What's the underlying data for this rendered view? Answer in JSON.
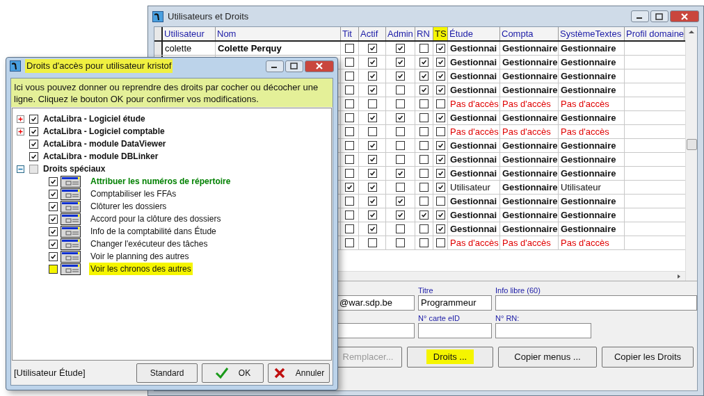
{
  "back_window": {
    "title": "Utilisateurs et Droits",
    "table": {
      "columns": [
        {
          "label": "Utilisateur",
          "highlighted": false
        },
        {
          "label": "Nom",
          "highlighted": false
        },
        {
          "label": "Tit",
          "highlighted": false
        },
        {
          "label": "Actif",
          "highlighted": false
        },
        {
          "label": "Admin",
          "highlighted": false
        },
        {
          "label": "RN",
          "highlighted": false
        },
        {
          "label": "TS",
          "highlighted": true
        },
        {
          "label": "Étude",
          "highlighted": false
        },
        {
          "label": "Compta",
          "highlighted": false
        },
        {
          "label": "SystèmeTextes",
          "highlighted": false
        },
        {
          "label": "Profil domaine",
          "highlighted": false
        }
      ],
      "rows": [
        {
          "utilisateur": "colette",
          "nom": "Colette Perquy",
          "flags": [
            false,
            true,
            true,
            false,
            true
          ],
          "cells": [
            {
              "text": "Gestionnai",
              "kind": "manager"
            },
            {
              "text": "Gestionnaire",
              "kind": "manager"
            },
            {
              "text": "Gestionnaire",
              "kind": "manager"
            }
          ]
        },
        {
          "flags": [
            false,
            true,
            true,
            true,
            true
          ],
          "cells": [
            {
              "text": "Gestionnai",
              "kind": "manager"
            },
            {
              "text": "Gestionnaire",
              "kind": "manager"
            },
            {
              "text": "Gestionnaire",
              "kind": "manager"
            }
          ]
        },
        {
          "flags": [
            false,
            true,
            true,
            true,
            true
          ],
          "cells": [
            {
              "text": "Gestionnai",
              "kind": "manager"
            },
            {
              "text": "Gestionnaire",
              "kind": "manager"
            },
            {
              "text": "Gestionnaire",
              "kind": "manager"
            }
          ]
        },
        {
          "flags": [
            false,
            true,
            false,
            true,
            true
          ],
          "cells": [
            {
              "text": "Gestionnai",
              "kind": "manager"
            },
            {
              "text": "Gestionnaire",
              "kind": "manager"
            },
            {
              "text": "Gestionnaire",
              "kind": "manager"
            }
          ]
        },
        {
          "flags": [
            false,
            false,
            false,
            false,
            false
          ],
          "cells": [
            {
              "text": "Pas d'accès",
              "kind": "none"
            },
            {
              "text": "Pas d'accès",
              "kind": "none"
            },
            {
              "text": "Pas d'accès",
              "kind": "none"
            }
          ]
        },
        {
          "flags": [
            false,
            true,
            true,
            false,
            true
          ],
          "cells": [
            {
              "text": "Gestionnai",
              "kind": "manager"
            },
            {
              "text": "Gestionnaire",
              "kind": "manager"
            },
            {
              "text": "Gestionnaire",
              "kind": "manager"
            }
          ]
        },
        {
          "flags": [
            false,
            false,
            false,
            false,
            false
          ],
          "cells": [
            {
              "text": "Pas d'accès",
              "kind": "none"
            },
            {
              "text": "Pas d'accès",
              "kind": "none"
            },
            {
              "text": "Pas d'accès",
              "kind": "none"
            }
          ]
        },
        {
          "flags": [
            false,
            true,
            false,
            false,
            true
          ],
          "cells": [
            {
              "text": "Gestionnai",
              "kind": "manager"
            },
            {
              "text": "Gestionnaire",
              "kind": "manager"
            },
            {
              "text": "Gestionnaire",
              "kind": "manager"
            }
          ]
        },
        {
          "flags": [
            false,
            true,
            false,
            false,
            true
          ],
          "cells": [
            {
              "text": "Gestionnai",
              "kind": "manager"
            },
            {
              "text": "Gestionnaire",
              "kind": "manager"
            },
            {
              "text": "Gestionnaire",
              "kind": "manager"
            }
          ]
        },
        {
          "flags": [
            false,
            true,
            true,
            false,
            true
          ],
          "cells": [
            {
              "text": "Gestionnai",
              "kind": "manager"
            },
            {
              "text": "Gestionnaire",
              "kind": "manager"
            },
            {
              "text": "Gestionnaire",
              "kind": "manager"
            }
          ]
        },
        {
          "flags": [
            true,
            true,
            false,
            false,
            true
          ],
          "cells": [
            {
              "text": "Utilisateur",
              "kind": "user"
            },
            {
              "text": "Gestionnaire",
              "kind": "manager"
            },
            {
              "text": "Utilisateur",
              "kind": "user"
            }
          ]
        },
        {
          "flags": [
            false,
            true,
            true,
            false,
            false
          ],
          "cells": [
            {
              "text": "Gestionnai",
              "kind": "manager"
            },
            {
              "text": "Gestionnaire",
              "kind": "manager"
            },
            {
              "text": "Gestionnaire",
              "kind": "manager"
            }
          ]
        },
        {
          "flags": [
            false,
            true,
            true,
            true,
            true
          ],
          "cells": [
            {
              "text": "Gestionnai",
              "kind": "manager"
            },
            {
              "text": "Gestionnaire",
              "kind": "manager"
            },
            {
              "text": "Gestionnaire",
              "kind": "manager"
            }
          ]
        },
        {
          "flags": [
            false,
            true,
            false,
            false,
            true
          ],
          "cells": [
            {
              "text": "Gestionnai",
              "kind": "manager"
            },
            {
              "text": "Gestionnaire",
              "kind": "manager"
            },
            {
              "text": "Gestionnaire",
              "kind": "manager"
            }
          ]
        },
        {
          "flags": [
            false,
            false,
            false,
            false,
            false
          ],
          "cells": [
            {
              "text": "Pas d'accès",
              "kind": "none"
            },
            {
              "text": "Pas d'accès",
              "kind": "none"
            },
            {
              "text": "Pas d'accès",
              "kind": "none"
            }
          ]
        }
      ]
    },
    "form": {
      "email": {
        "value": "@war.sdp.be"
      },
      "titre": {
        "label": "Titre",
        "value": "Programmeur"
      },
      "info_libre": {
        "label": "Info libre (60)"
      },
      "carte_eid": {
        "label": "N° carte eID"
      },
      "rn": {
        "label": "N° RN:"
      }
    },
    "buttons": [
      {
        "label": "Remplacer...",
        "disabled": true,
        "highlighted": false
      },
      {
        "label": "Droits ...",
        "disabled": false,
        "highlighted": true
      },
      {
        "label": "Copier menus ...",
        "disabled": false,
        "highlighted": false
      },
      {
        "label": "Copier les Droits",
        "disabled": false,
        "highlighted": false
      }
    ]
  },
  "dialog": {
    "title": "Droits d'accès pour utilisateur kristof",
    "title_highlighted": true,
    "info": "Ici vous pouvez donner ou reprendre des droits par cocher ou décocher une ligne.  Cliquez le bouton OK pour confirmer vos modifications.",
    "tree": [
      {
        "label": "ActaLibra - Logiciel étude",
        "checked": true,
        "indeterminate": false,
        "expanded": false
      },
      {
        "label": "ActaLibra - Logiciel comptable",
        "checked": true,
        "indeterminate": false,
        "expanded": false
      },
      {
        "label": "ActaLibra - module DataViewer",
        "checked": true,
        "indeterminate": false
      },
      {
        "label": "ActaLibra - module DBLinker",
        "checked": true,
        "indeterminate": false
      },
      {
        "label": "Droits spéciaux",
        "checked": false,
        "indeterminate": true,
        "expanded": true,
        "children": [
          {
            "label": "Attribuer les numéros de répertoire",
            "checked": true,
            "kind": "primary",
            "highlighted": false
          },
          {
            "label": "Comptabiliser les FFAs",
            "checked": true,
            "kind": "normal",
            "highlighted": false
          },
          {
            "label": "Clôturer les dossiers",
            "checked": true,
            "kind": "normal",
            "highlighted": false
          },
          {
            "label": "Accord pour la clôture des dossiers",
            "checked": true,
            "kind": "normal",
            "highlighted": false
          },
          {
            "label": "Info de la comptabilité dans Étude",
            "checked": true,
            "kind": "normal",
            "highlighted": false
          },
          {
            "label": "Changer l'exécuteur des tâches",
            "checked": true,
            "kind": "normal",
            "highlighted": false
          },
          {
            "label": "Voir le planning des autres",
            "checked": true,
            "kind": "normal",
            "highlighted": false
          },
          {
            "label": "Voir les chronos des autres",
            "checked": false,
            "kind": "normal",
            "highlighted": true
          }
        ]
      }
    ],
    "status": "[Utilisateur Étude]",
    "buttons": [
      {
        "label": "Standard",
        "kind": "standard"
      },
      {
        "label": "OK",
        "kind": "ok"
      },
      {
        "label": "Annuler",
        "kind": "cancel"
      }
    ]
  }
}
